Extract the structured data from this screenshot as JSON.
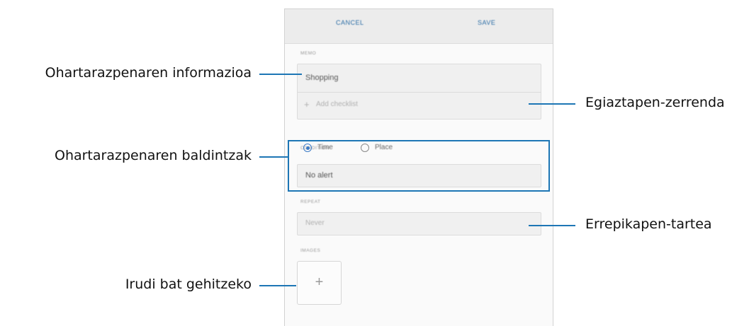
{
  "screen": {
    "toolbar": {
      "cancel_label": "CANCEL",
      "save_label": "SAVE"
    },
    "memo": {
      "section_label": "MEMO",
      "title_value": "Shopping",
      "add_checklist_label": "Add checklist"
    },
    "condition": {
      "section_label": "CONDITION",
      "options": [
        {
          "label": "Time",
          "selected": true
        },
        {
          "label": "Place",
          "selected": false
        }
      ],
      "alert_value": "No alert"
    },
    "repeat": {
      "section_label": "REPEAT",
      "value": "Never"
    },
    "images": {
      "section_label": "IMAGES",
      "add_icon": "plus-icon"
    }
  },
  "callouts": {
    "reminder_info": "Ohartarazpenaren informazioa",
    "reminder_conditions": "Ohartarazpenaren baldintzak",
    "add_image": "Irudi bat gehitzeko",
    "checklist": "Egiaztapen-zerrenda",
    "repeat_interval": "Errepikapen-tartea"
  },
  "colors": {
    "highlight": "#1d76b5",
    "accent": "#3c7bc6"
  }
}
